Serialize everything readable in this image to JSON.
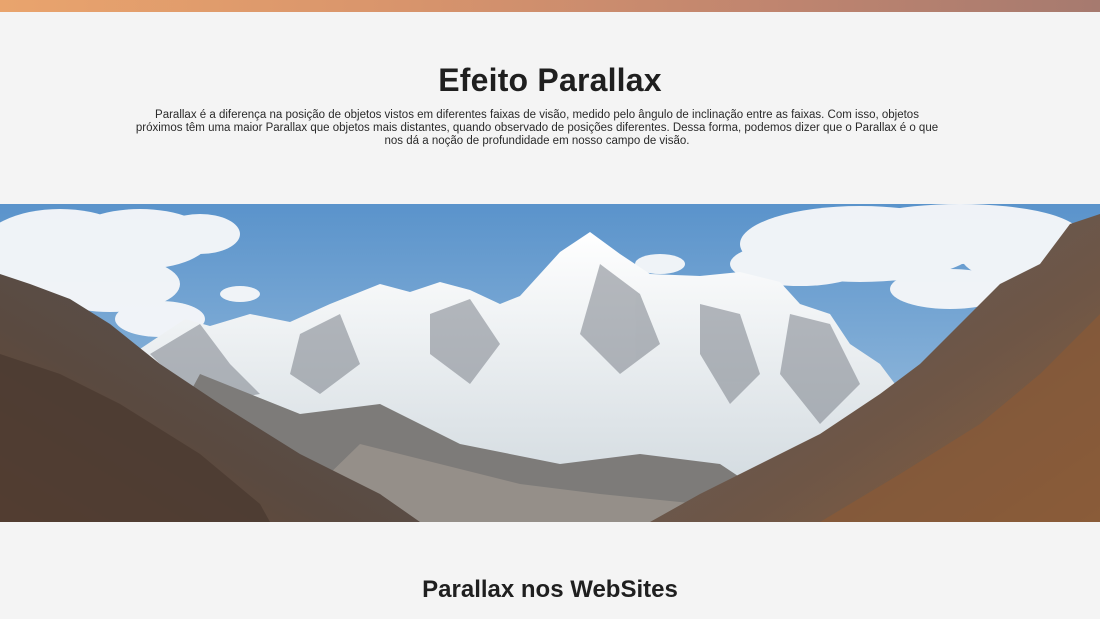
{
  "section_intro": {
    "title": "Efeito Parallax",
    "paragraph": "Parallax é a diferença na posição de objetos vistos em diferentes faixas de visão, medido pelo ângulo de inclinação entre as faixas. Com isso, objetos próximos têm uma maior Parallax que objetos mais distantes, quando observado de posições diferentes. Dessa forma, podemos dizer que o Parallax é o que nos dá a noção de profundidade em nosso campo de visão."
  },
  "parallax_image": {
    "subject": "snow-capped-mountain-landscape",
    "colors": {
      "sky": "#5f97cd",
      "snow": "#eef2f5",
      "rock_dark": "#4b4a4c",
      "slope_brown": "#7a5a45"
    }
  },
  "section_websites": {
    "title": "Parallax nos WebSites"
  },
  "theme": {
    "top_band_start": "#e9a46d",
    "top_band_end": "#a67a6f",
    "page_background": "#f4f4f4",
    "text_color": "#1f1f1f"
  }
}
